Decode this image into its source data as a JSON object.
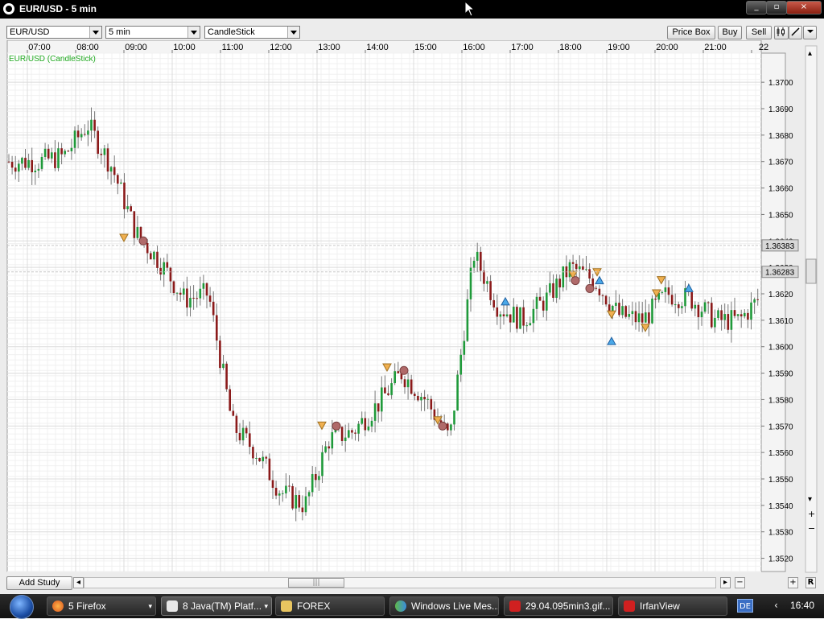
{
  "window": {
    "title": "EUR/USD - 5 min",
    "buttons": [
      "_",
      "▫",
      "×"
    ]
  },
  "toolbar": {
    "instrument": "EUR/USD",
    "period": "5 min",
    "chart_type": "CandleStick",
    "price_box_label": "Price Box",
    "buy_label": "Buy",
    "sell_label": "Sell"
  },
  "chart": {
    "legend": "EUR/USD (CandleStick)",
    "current_price": "1.36283",
    "other_price": "1.36383",
    "colors": {
      "up": "#1f9a3a",
      "down": "#8b1a1a",
      "grid": "#dcdcdc",
      "legend": "#22aa22",
      "sell_marker": "#f0b050",
      "buy_marker": "#4aa8e8",
      "close_marker": "#b06a6a"
    }
  },
  "chart_data": {
    "type": "line",
    "x": [
      "07:00",
      "07:30",
      "08:00",
      "08:30",
      "09:00",
      "09:30",
      "10:00",
      "10:30",
      "11:00",
      "11:30",
      "12:00",
      "12:30",
      "13:00",
      "13:30",
      "14:00",
      "14:30",
      "15:00",
      "15:30",
      "16:00",
      "16:30",
      "17:00",
      "17:30",
      "18:00",
      "18:30",
      "19:00",
      "19:30",
      "20:00",
      "20:30",
      "21:00",
      "21:30",
      "22:00"
    ],
    "series": [
      {
        "values": [
          1.367,
          1.3672,
          1.3684,
          1.3668,
          1.3643,
          1.3632,
          1.3618,
          1.362,
          1.357,
          1.356,
          1.3545,
          1.354,
          1.3565,
          1.3568,
          1.3578,
          1.359,
          1.358,
          1.3565,
          1.3635,
          1.3615,
          1.361,
          1.3618,
          1.363,
          1.3625,
          1.3612,
          1.361,
          1.362,
          1.3618,
          1.361,
          1.361,
          1.362
        ]
      }
    ],
    "xlabel": "",
    "ylabel": "",
    "ylim": [
      1.3515,
      1.3711
    ],
    "yticks": [
      "1.3700",
      "1.3690",
      "1.3680",
      "1.3670",
      "1.3660",
      "1.3650",
      "1.3640",
      "1.3630",
      "1.3620",
      "1.3610",
      "1.3600",
      "1.3590",
      "1.3580",
      "1.3570",
      "1.3560",
      "1.3550",
      "1.3540",
      "1.3530",
      "1.3520"
    ],
    "xticks": [
      "07:00",
      "08:00",
      "09:00",
      "10:00",
      "11:00",
      "12:00",
      "13:00",
      "14:00",
      "15:00",
      "16:00",
      "17:00",
      "18:00",
      "19:00",
      "20:00",
      "21:00",
      "22"
    ],
    "grid": true
  },
  "bottombar": {
    "add_study": "Add Study",
    "r_label": "R"
  },
  "taskbar": {
    "items": [
      {
        "label": "5 Firefox",
        "icon": "firefox-icon"
      },
      {
        "label": "8 Java(TM) Platf...",
        "icon": "java-icon"
      },
      {
        "label": "FOREX",
        "icon": "folder-icon"
      },
      {
        "label": "Windows Live Mes...",
        "icon": "messenger-icon"
      },
      {
        "label": "29.04.095min3.gif...",
        "icon": "image-icon"
      },
      {
        "label": "IrfanView",
        "icon": "irfanview-icon"
      }
    ],
    "lang": "DE",
    "clock": "16:40"
  }
}
